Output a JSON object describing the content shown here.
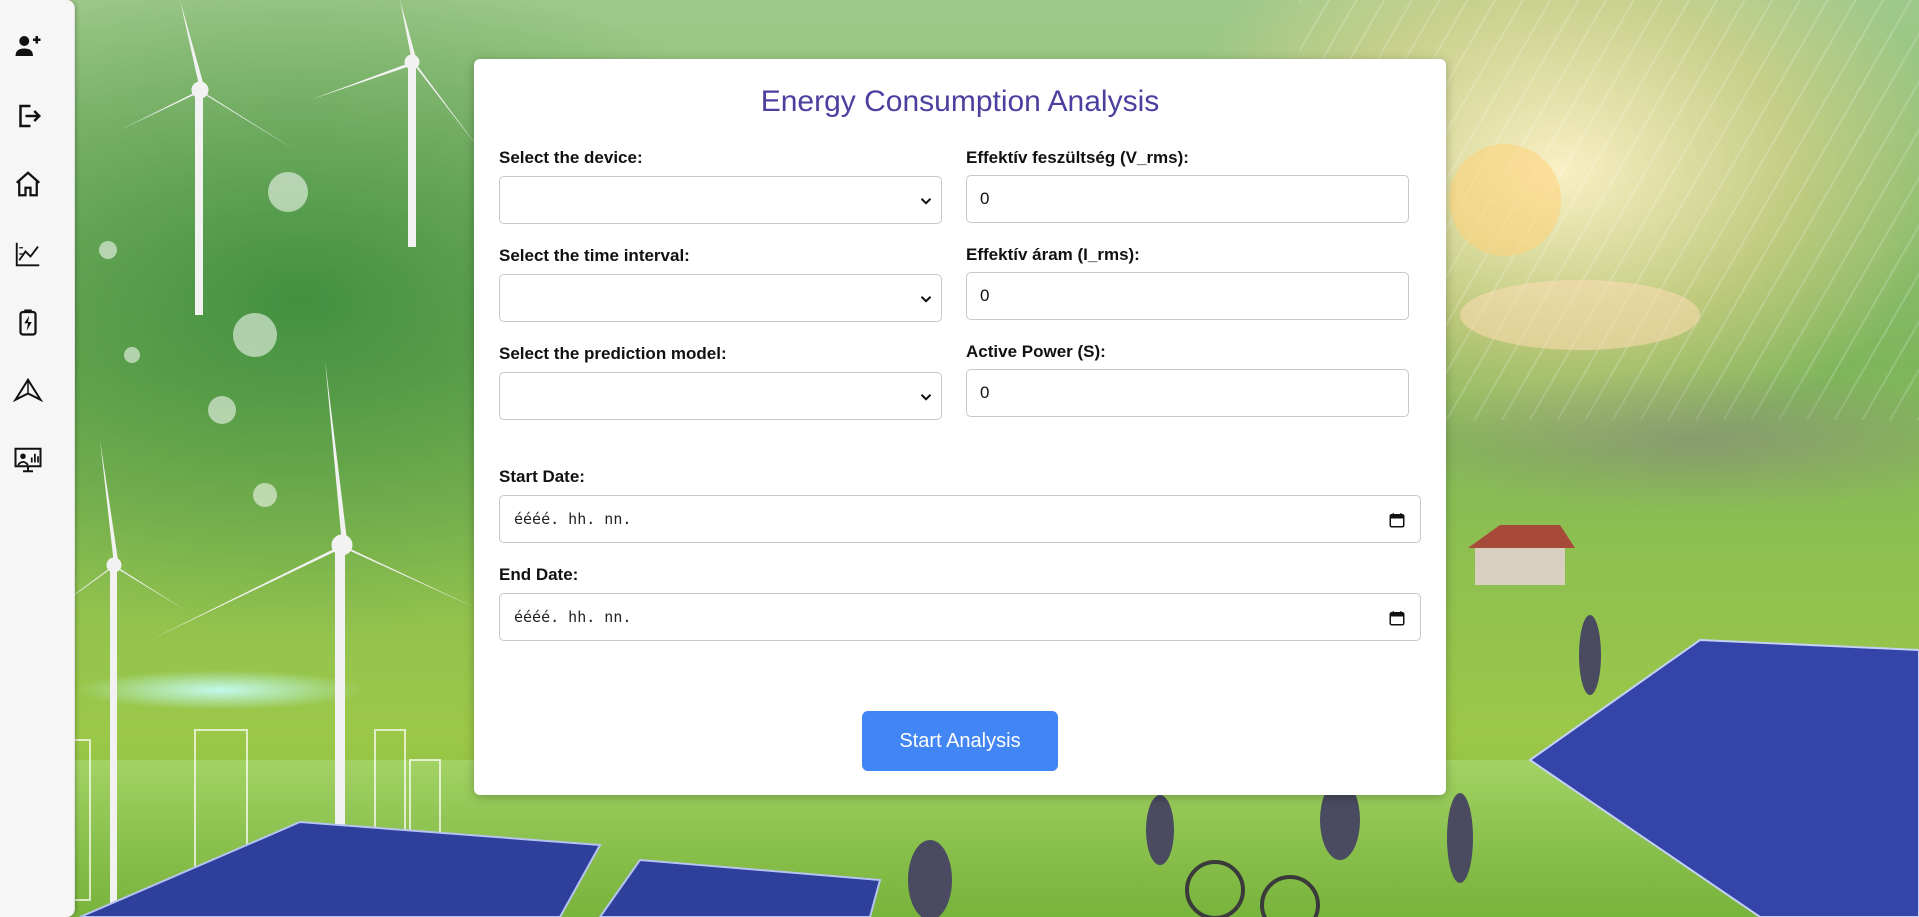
{
  "sidebar": {
    "items": [
      {
        "icon": "add-user-icon"
      },
      {
        "icon": "logout-icon"
      },
      {
        "icon": "home-icon"
      },
      {
        "icon": "chart-icon"
      },
      {
        "icon": "battery-charging-icon"
      },
      {
        "icon": "paper-plane-icon"
      },
      {
        "icon": "presentation-icon"
      }
    ]
  },
  "form": {
    "title": "Energy Consumption Analysis",
    "device_label": "Select the device:",
    "device_value": "",
    "interval_label": "Select the time interval:",
    "interval_value": "",
    "model_label": "Select the prediction model:",
    "model_value": "",
    "vrms_label": "Effektív feszültség (V_rms):",
    "vrms_value": "0",
    "irms_label": "Effektív áram (I_rms):",
    "irms_value": "0",
    "power_label": "Active Power (S):",
    "power_value": "0",
    "start_date_label": "Start Date:",
    "start_date_placeholder": "éééé. hh. nn.",
    "end_date_label": "End Date:",
    "end_date_placeholder": "éééé. hh. nn.",
    "submit_label": "Start Analysis"
  },
  "colors": {
    "title": "#4b3fa0",
    "button": "#4285f4",
    "sidebar": "#f6f6f6"
  }
}
